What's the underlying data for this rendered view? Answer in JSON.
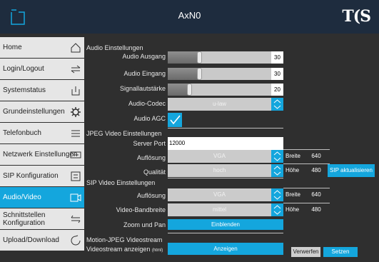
{
  "header": {
    "title": "AxN0"
  },
  "sidebar": {
    "items": [
      {
        "label": "Home",
        "icon": "home-icon"
      },
      {
        "label": "Login/Logout",
        "icon": "login-icon"
      },
      {
        "label": "Systemstatus",
        "icon": "status-icon"
      },
      {
        "label": "Grundeinstellungen",
        "icon": "gear-icon"
      },
      {
        "label": "Telefonbuch",
        "icon": "list-icon"
      },
      {
        "label": "Netzwerk Einstellungen",
        "icon": "network-icon"
      },
      {
        "label": "SIP Konfiguration",
        "icon": "sip-icon"
      },
      {
        "label": "Audio/Video",
        "icon": "video-camera-icon",
        "active": true
      },
      {
        "label": "Schnittstellen Konfiguration",
        "icon": "interface-icon"
      },
      {
        "label": "Upload/Download",
        "icon": "upload-icon"
      }
    ]
  },
  "audio": {
    "section_title": "Audio Einstellungen",
    "output_label": "Audio Ausgang",
    "output_value": "30",
    "input_label": "Audio Eingang",
    "input_value": "30",
    "signal_label": "Signallautstärke",
    "signal_value": "20",
    "codec_label": "Audio-Codec",
    "codec_value": "u-law",
    "agc_label": "Audio AGC",
    "agc_checked": true
  },
  "jpeg": {
    "section_title": "JPEG Video Einstellungen",
    "port_label": "Server Port",
    "port_value": "12000",
    "res_label": "Auflösung",
    "res_value": "VGA",
    "quality_label": "Qualität",
    "quality_value": "hoch",
    "width_label": "Breite",
    "width_value": "640",
    "height_label": "Höhe",
    "height_value": "480"
  },
  "sip_video": {
    "section_title": "SIP Video Einstellungen",
    "res_label": "Auflösung",
    "res_value": "VGA",
    "bw_label": "Video-Bandbreite",
    "bw_value": "mittel",
    "width_label": "Breite",
    "width_value": "640",
    "height_label": "Höhe",
    "height_value": "480",
    "update_button": "SIP aktualisieren"
  },
  "zoom": {
    "label": "Zoom und Pan",
    "button": "Einblenden"
  },
  "mjpeg": {
    "title": "Motion-JPEG Videostream",
    "show_label": "Videostream anzeigen",
    "show_suffix": "(html)",
    "button": "Anzeigen"
  },
  "actions": {
    "discard": "Verwerfen",
    "save": "Setzen"
  },
  "colors": {
    "accent": "#14a6dd",
    "header": "#1e2c3e",
    "background": "#2f2f2f"
  }
}
